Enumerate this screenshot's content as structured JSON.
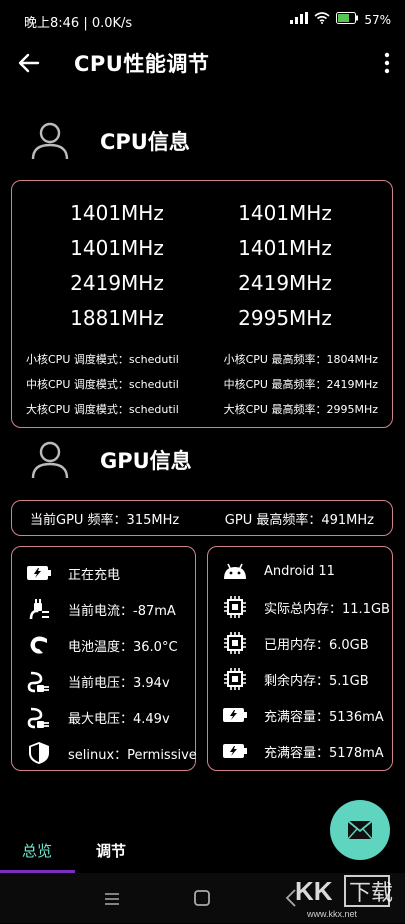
{
  "status": {
    "time": "晚上8:46 | 0.0K/s",
    "battery": "57%"
  },
  "appbar": {
    "title": "CPU性能调节"
  },
  "cpu_section": {
    "title": "CPU信息",
    "freqs": [
      [
        "1401MHz",
        "1401MHz"
      ],
      [
        "1401MHz",
        "1401MHz"
      ],
      [
        "2419MHz",
        "2419MHz"
      ],
      [
        "1881MHz",
        "2995MHz"
      ]
    ],
    "info_rows": [
      {
        "left": "小核CPU 调度模式：schedutil",
        "right": "小核CPU 最高频率：1804MHz"
      },
      {
        "left": "中核CPU 调度模式：schedutil",
        "right": "中核CPU 最高频率：2419MHz"
      },
      {
        "left": "大核CPU 调度模式：schedutil",
        "right": "大核CPU 最高频率：2995MHz"
      }
    ]
  },
  "gpu_section": {
    "title": "GPU信息",
    "current": "当前GPU 频率：315MHz",
    "max": "GPU 最高频率：491MHz"
  },
  "battery_list": [
    {
      "icon": "battery-charging-icon",
      "text": "正在充电"
    },
    {
      "icon": "plug-icon",
      "text": "当前电流：-87mA"
    },
    {
      "icon": "temperature-icon",
      "text": "电池温度：36.0°C"
    },
    {
      "icon": "plug-voltage-icon",
      "text": "当前电压：3.94v"
    },
    {
      "icon": "plug-voltage-icon",
      "text": "最大电压：4.49v"
    },
    {
      "icon": "shield-icon",
      "text": "selinux：Permissive"
    }
  ],
  "system_list": [
    {
      "icon": "android-icon",
      "text": "Android 11"
    },
    {
      "icon": "chip-icon",
      "text": "实际总内存：11.1GB"
    },
    {
      "icon": "chip-icon",
      "text": "已用内存：6.0GB"
    },
    {
      "icon": "chip-icon",
      "text": "剩余内存：5.1GB"
    },
    {
      "icon": "battery-charging-icon",
      "text": "充满容量：5136mA"
    },
    {
      "icon": "battery-charging-icon",
      "text": "充满容量：5178mA"
    }
  ],
  "tabs": {
    "overview": "总览",
    "adjust": "调节"
  },
  "watermark": "KK下载 www.kkx.net",
  "colors": {
    "card_border": "#d3828a",
    "accent": "#5fd5c0",
    "indicator": "#7a2fbf"
  }
}
